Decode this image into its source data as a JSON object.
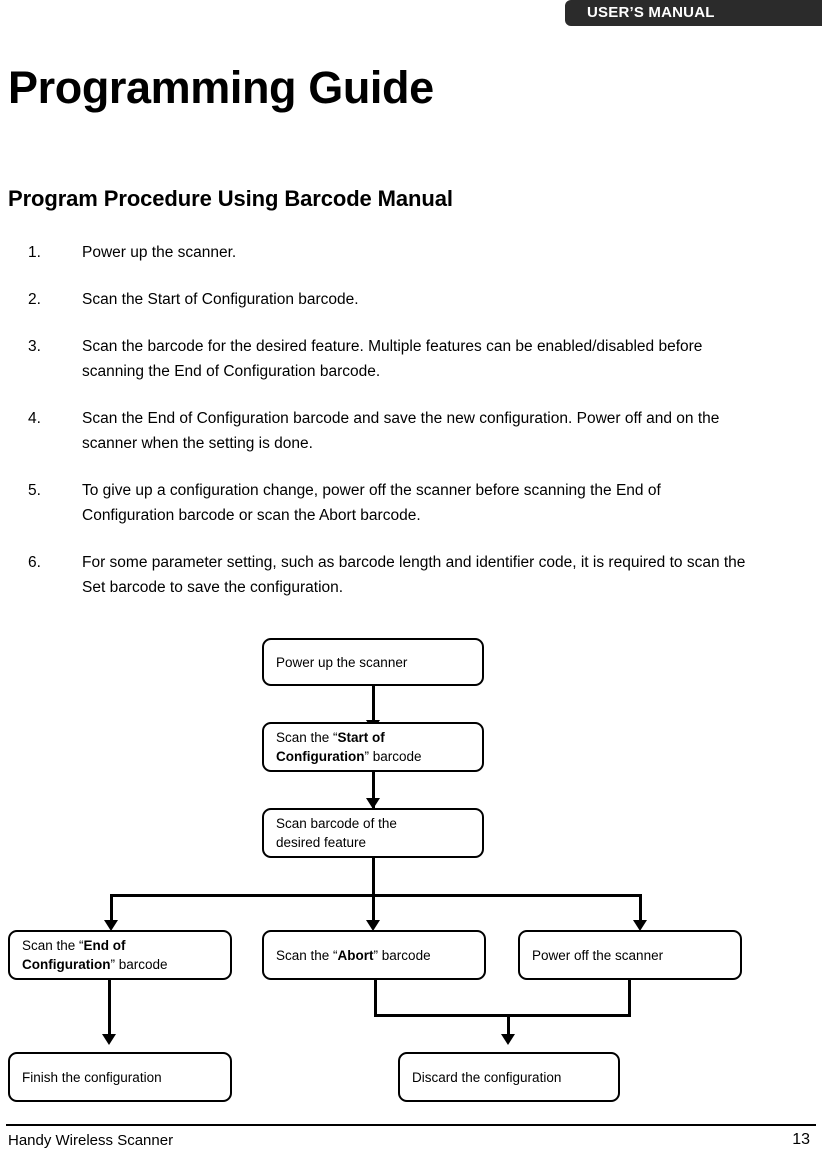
{
  "header": {
    "banner_label": "USER’S MANUAL",
    "banner_color": "#2b2b2b"
  },
  "page_title": "Programming Guide",
  "section_title": "Program Procedure Using Barcode Manual",
  "steps": [
    {
      "num": "1.",
      "text": "Power up the scanner."
    },
    {
      "num": "2.",
      "text": "Scan the Start of Configuration barcode."
    },
    {
      "num": "3.",
      "text": "Scan the barcode for the desired feature. Multiple features can be enabled/disabled before scanning the End of Configuration barcode."
    },
    {
      "num": "4.",
      "text": "Scan the End of Configuration barcode and save the new configuration. Power off and on the scanner when the setting is done."
    },
    {
      "num": "5.",
      "text": "To give up a configuration change, power off the scanner before scanning the End of Configuration barcode or scan the Abort barcode."
    },
    {
      "num": "6.",
      "text": "For some parameter setting, such as barcode length and identifier code, it is required to scan the Set barcode to save the configuration."
    }
  ],
  "flowchart": {
    "type": "flowchart",
    "nodes": {
      "power_up": "Power up the scanner",
      "start_config_pre": "Scan the “",
      "start_config_bold": "Start of Configuration",
      "start_config_post": "” barcode",
      "scan_feature": "Scan barcode of the desired feature",
      "end_config_pre": "Scan the “",
      "end_config_bold": "End of Configuration",
      "end_config_post": "” barcode",
      "abort_pre": "Scan the “",
      "abort_bold": "Abort",
      "abort_post": "” barcode",
      "power_off": "Power off the scanner",
      "finish": "Finish the configuration",
      "discard": "Discard the configuration"
    }
  },
  "footer": {
    "product": "Handy Wireless Scanner",
    "page_number": "13"
  }
}
